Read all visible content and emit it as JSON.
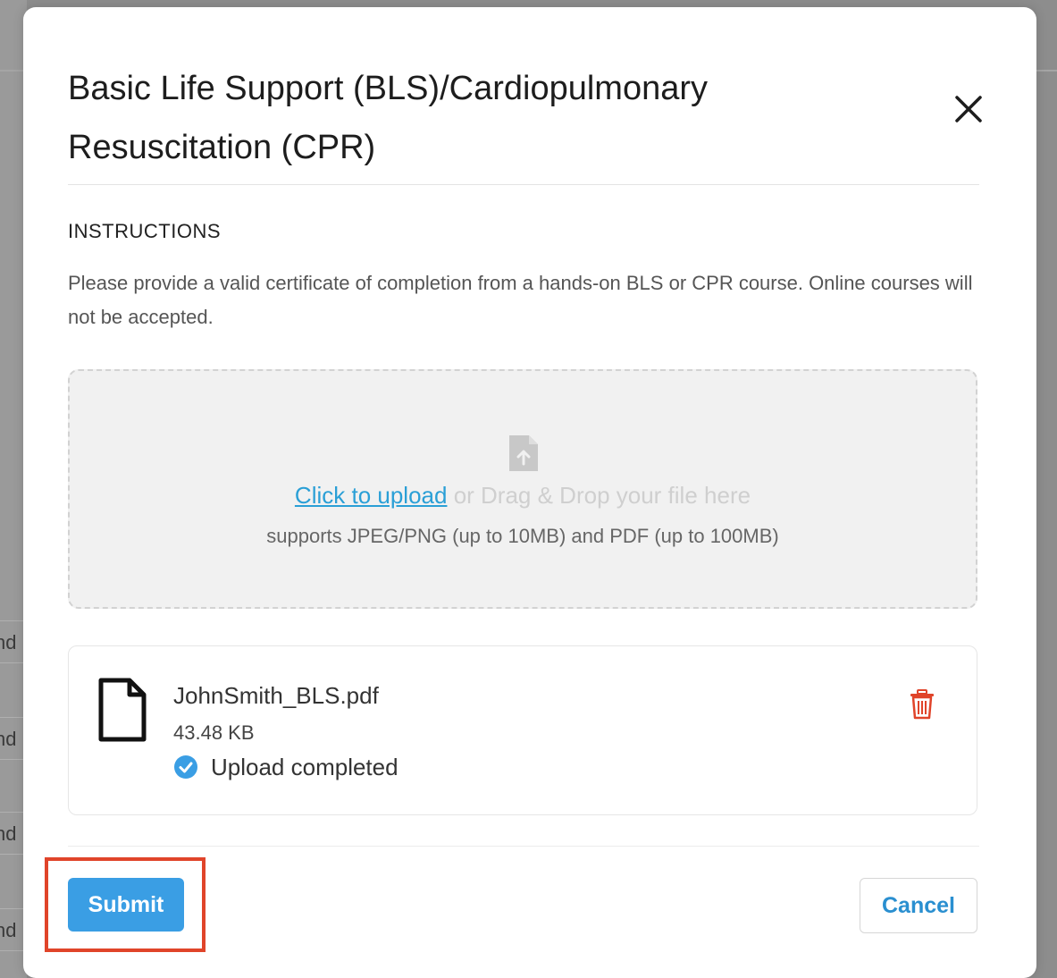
{
  "background": {
    "row_fragments": [
      "nd",
      "nd",
      "nd",
      "nd"
    ]
  },
  "modal": {
    "title": "Basic Life Support (BLS)/Cardiopulmonary Resuscitation (CPR)",
    "close_icon": "close-icon",
    "instructions_heading": "INSTRUCTIONS",
    "instructions_text": "Please provide a valid certificate of completion from a hands-on BLS or CPR course. Online courses will not be accepted."
  },
  "dropzone": {
    "icon": "file-upload-icon",
    "link_label": "Click to upload",
    "drag_text": " or Drag & Drop your file here",
    "supports_text": "supports JPEG/PNG (up to 10MB) and PDF (up to 100MB)"
  },
  "uploaded_file": {
    "icon": "file-icon",
    "name": "JohnSmith_BLS.pdf",
    "size": "43.48 KB",
    "status": "Upload completed",
    "status_icon": "check-circle-icon",
    "delete_icon": "trash-icon"
  },
  "footer": {
    "submit_label": "Submit",
    "cancel_label": "Cancel"
  },
  "colors": {
    "accent": "#3a9ee4",
    "link": "#2a9fd6",
    "danger": "#e0442a",
    "highlight": "#e0442a"
  }
}
